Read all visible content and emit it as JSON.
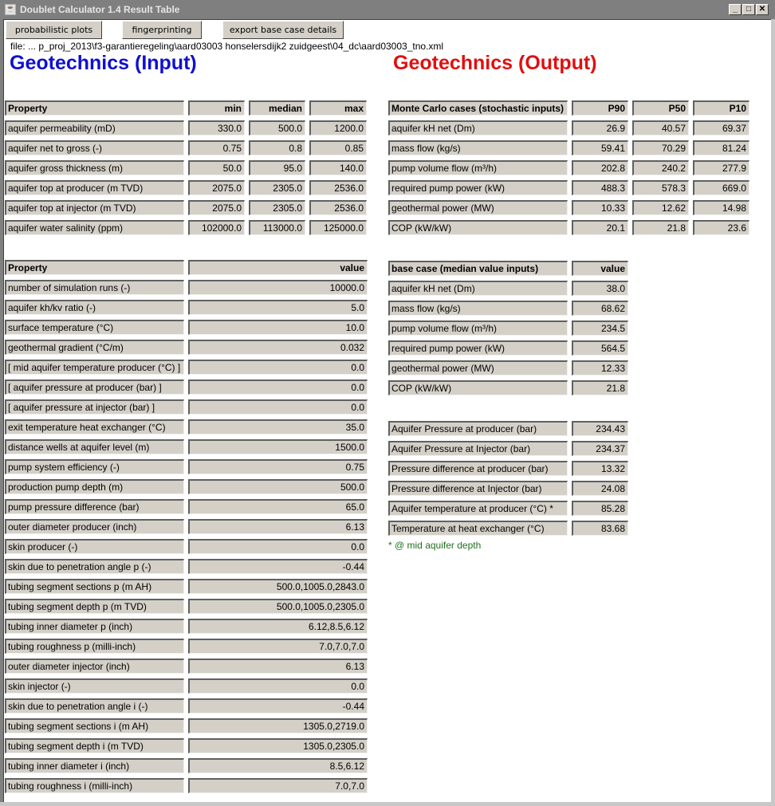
{
  "window": {
    "title": "Doublet Calculator 1.4 Result Table",
    "controls": [
      "minimize",
      "maximize",
      "close"
    ]
  },
  "toolbar": {
    "buttons": [
      "probabilistic plots",
      "fingerprinting",
      "export base case details"
    ]
  },
  "file_path": "file:  ... p_proj_2013\\f3-garantieregeling\\aard03003 honselersdijk2 zuidgeest\\04_dc\\aard03003_tno.xml",
  "colors": {
    "input_heading": "#1010d0",
    "output_heading": "#e01010",
    "footnote": "#207020"
  },
  "input": {
    "heading": "Geotechnics (Input)",
    "stochastic_table": {
      "headers": [
        "Property",
        "min",
        "median",
        "max"
      ],
      "rows": [
        [
          "aquifer permeability (mD)",
          "330.0",
          "500.0",
          "1200.0"
        ],
        [
          "aquifer net to gross (-)",
          "0.75",
          "0.8",
          "0.85"
        ],
        [
          "aquifer gross thickness (m)",
          "50.0",
          "95.0",
          "140.0"
        ],
        [
          "aquifer top at producer (m TVD)",
          "2075.0",
          "2305.0",
          "2536.0"
        ],
        [
          "aquifer top at injector (m TVD)",
          "2075.0",
          "2305.0",
          "2536.0"
        ],
        [
          "aquifer water salinity (ppm)",
          "102000.0",
          "113000.0",
          "125000.0"
        ]
      ]
    },
    "deterministic_table": {
      "headers": [
        "Property",
        "value"
      ],
      "rows": [
        [
          "number of simulation runs (-)",
          "10000.0"
        ],
        [
          "aquifer kh/kv ratio (-)",
          "5.0"
        ],
        [
          "surface temperature (°C)",
          "10.0"
        ],
        [
          "geothermal gradient (°C/m)",
          "0.032"
        ],
        [
          "[ mid aquifer temperature producer (°C) ]",
          "0.0"
        ],
        [
          "[ aquifer pressure at producer (bar) ]",
          "0.0"
        ],
        [
          "[ aquifer pressure at injector (bar) ]",
          "0.0"
        ],
        [
          "exit temperature heat exchanger (°C)",
          "35.0"
        ],
        [
          "distance wells at aquifer level (m)",
          "1500.0"
        ],
        [
          "pump system efficiency (-)",
          "0.75"
        ],
        [
          "production pump depth (m)",
          "500.0"
        ],
        [
          "pump pressure difference (bar)",
          "65.0"
        ],
        [
          "outer diameter producer (inch)",
          "6.13"
        ],
        [
          "skin producer (-)",
          "0.0"
        ],
        [
          "skin due to penetration angle p (-)",
          "-0.44"
        ],
        [
          "tubing segment sections p (m AH)",
          "500.0,1005.0,2843.0"
        ],
        [
          "tubing segment depth p (m TVD)",
          "500.0,1005.0,2305.0"
        ],
        [
          "tubing inner diameter p (inch)",
          "6.12,8.5,6.12"
        ],
        [
          "tubing roughness p (milli-inch)",
          "7.0,7.0,7.0"
        ],
        [
          "outer diameter injector (inch)",
          "6.13"
        ],
        [
          "skin injector (-)",
          "0.0"
        ],
        [
          "skin due to penetration angle i (-)",
          "-0.44"
        ],
        [
          "tubing segment sections i (m AH)",
          "1305.0,2719.0"
        ],
        [
          "tubing segment depth i (m TVD)",
          "1305.0,2305.0"
        ],
        [
          "tubing inner diameter i  (inch)",
          "8.5,6.12"
        ],
        [
          "tubing roughness i (milli-inch)",
          "7.0,7.0"
        ]
      ]
    }
  },
  "output": {
    "heading": "Geotechnics (Output)",
    "monte_carlo_table": {
      "headers": [
        "Monte Carlo cases (stochastic inputs)",
        "P90",
        "P50",
        "P10"
      ],
      "rows": [
        [
          "aquifer kH net (Dm)",
          "26.9",
          "40.57",
          "69.37"
        ],
        [
          "mass flow (kg/s)",
          "59.41",
          "70.29",
          "81.24"
        ],
        [
          "pump volume flow (m³/h)",
          "202.8",
          "240.2",
          "277.9"
        ],
        [
          "required pump power (kW)",
          "488.3",
          "578.3",
          "669.0"
        ],
        [
          "geothermal power (MW)",
          "10.33",
          "12.62",
          "14.98"
        ],
        [
          "COP (kW/kW)",
          "20.1",
          "21.8",
          "23.6"
        ]
      ]
    },
    "base_case_table": {
      "headers": [
        "base case (median value inputs)",
        "value"
      ],
      "rows": [
        [
          "aquifer kH net (Dm)",
          "38.0"
        ],
        [
          "mass flow (kg/s)",
          "68.62"
        ],
        [
          "pump volume flow (m³/h)",
          "234.5"
        ],
        [
          "required pump power (kW)",
          "564.5"
        ],
        [
          "geothermal power (MW)",
          "12.33"
        ],
        [
          "COP (kW/kW)",
          "21.8"
        ]
      ]
    },
    "pressure_table": {
      "rows": [
        [
          "Aquifer Pressure at producer (bar)",
          "234.43"
        ],
        [
          "Aquifer Pressure at Injector (bar)",
          "234.37"
        ],
        [
          "Pressure difference at producer (bar)",
          "13.32"
        ],
        [
          "Pressure difference at Injector (bar)",
          "24.08"
        ],
        [
          "Aquifer temperature at producer (°C) *",
          "85.28"
        ],
        [
          "Temperature at heat exchanger (°C)",
          "83.68"
        ]
      ]
    },
    "footnote": "* @ mid aquifer depth"
  }
}
